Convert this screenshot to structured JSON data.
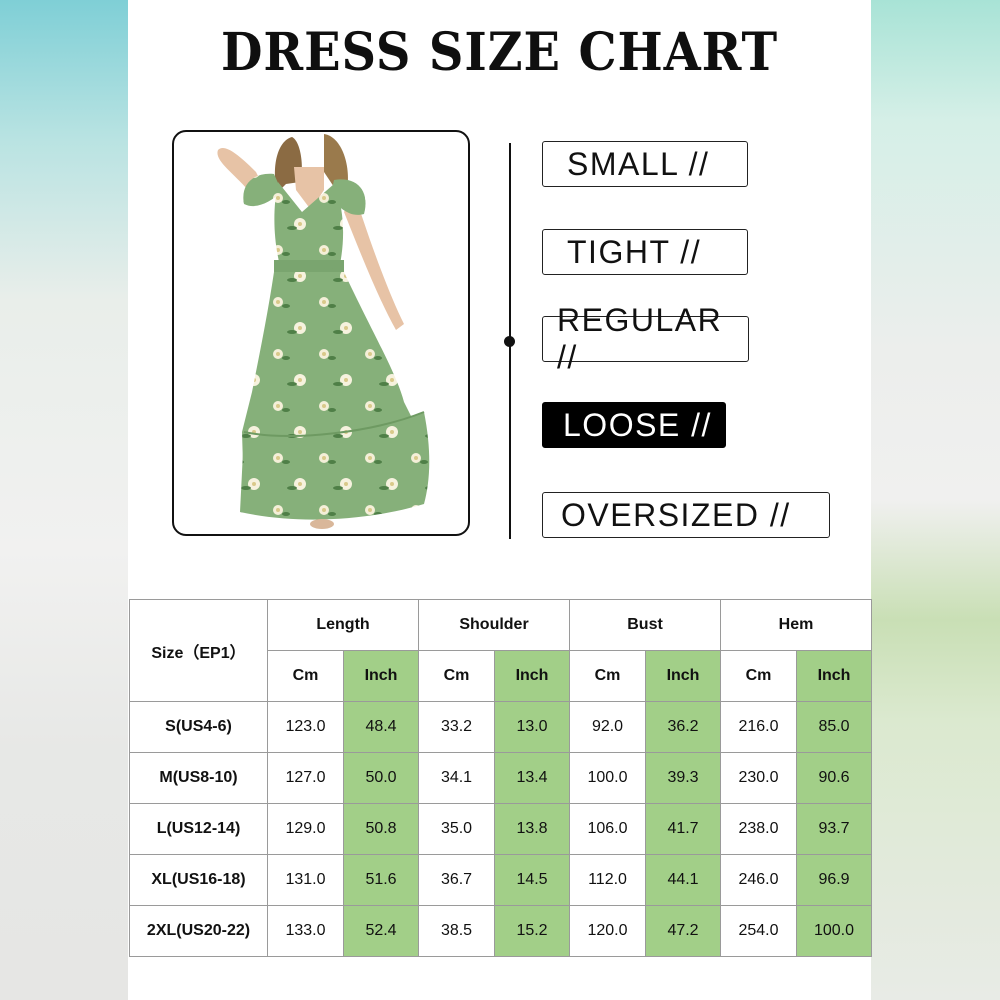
{
  "title": "DRESS SIZE CHART",
  "fit_scale": [
    {
      "label": "SMALL //",
      "selected": false
    },
    {
      "label": "TIGHT //",
      "selected": false
    },
    {
      "label": "REGULAR //",
      "selected": false
    },
    {
      "label": "LOOSE //",
      "selected": true
    },
    {
      "label": "OVERSIZED //",
      "selected": false
    }
  ],
  "colors": {
    "inch_column": "#a2cf88",
    "dress": "#86b07a",
    "selected_fit": "#000000"
  },
  "table": {
    "size_header": "Size（EP1）",
    "groups": [
      "Length",
      "Shoulder",
      "Bust",
      "Hem"
    ],
    "units": [
      "Cm",
      "Inch"
    ],
    "rows": [
      {
        "size": "S(US4-6)",
        "values": [
          "123.0",
          "48.4",
          "33.2",
          "13.0",
          "92.0",
          "36.2",
          "216.0",
          "85.0"
        ]
      },
      {
        "size": "M(US8-10)",
        "values": [
          "127.0",
          "50.0",
          "34.1",
          "13.4",
          "100.0",
          "39.3",
          "230.0",
          "90.6"
        ]
      },
      {
        "size": "L(US12-14)",
        "values": [
          "129.0",
          "50.8",
          "35.0",
          "13.8",
          "106.0",
          "41.7",
          "238.0",
          "93.7"
        ]
      },
      {
        "size": "XL(US16-18)",
        "values": [
          "131.0",
          "51.6",
          "36.7",
          "14.5",
          "112.0",
          "44.1",
          "246.0",
          "96.9"
        ]
      },
      {
        "size": "2XL(US20-22)",
        "values": [
          "133.0",
          "52.4",
          "38.5",
          "15.2",
          "120.0",
          "47.2",
          "254.0",
          "100.0"
        ]
      }
    ]
  }
}
